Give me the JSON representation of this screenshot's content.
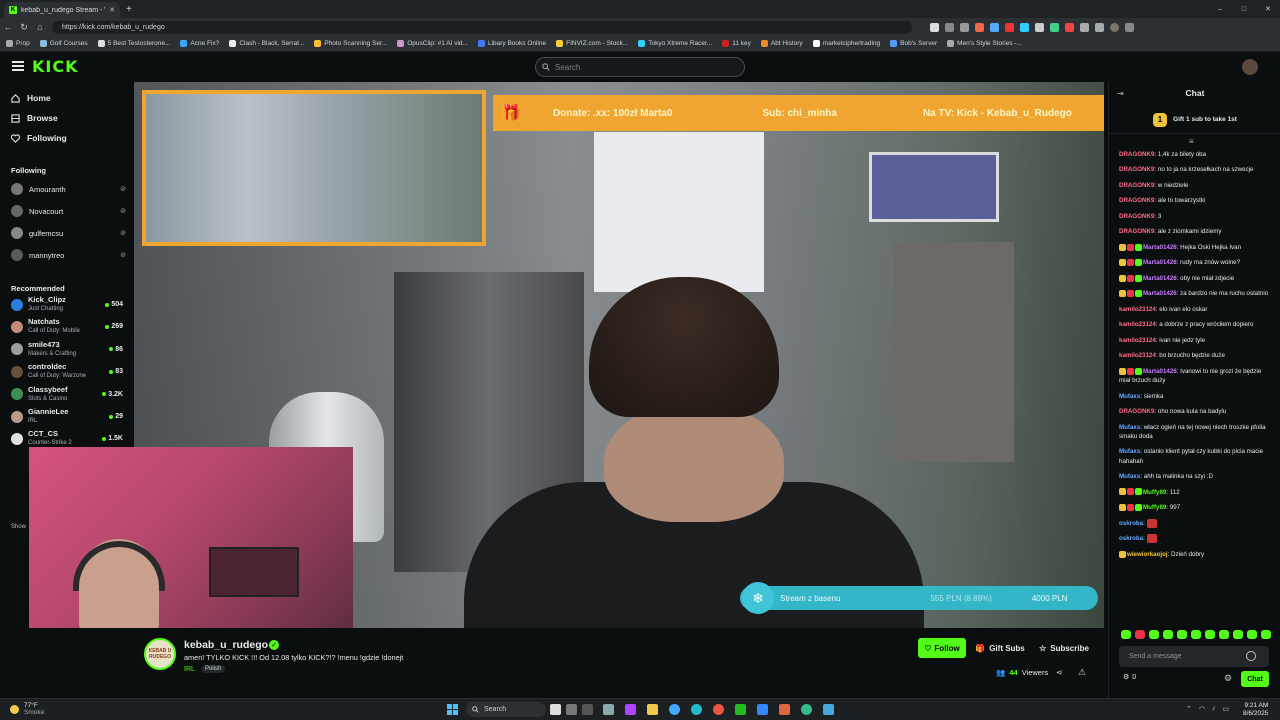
{
  "browser": {
    "tab_title": "kebab_u_rudego Stream - W",
    "new_tab": "+",
    "url": "https://kick.com/kebab_u_rudego",
    "bookmarks": [
      "Prop",
      "Golf Courses",
      "5 Best Testosterone...",
      "Acne Fix?",
      "Clash - Black, Serrat...",
      "Photo Scanning Ser...",
      "OpusClip: #1 AI vid...",
      "Libary Books Online",
      "FINVIZ.com - Stock...",
      "Tokyo Xtreme Racer...",
      "11 key",
      "Abt History",
      "marketciphertrading",
      "Bob's Server",
      "Men's Style Stories -..."
    ]
  },
  "header": {
    "logo": "KICK",
    "search_placeholder": "Search"
  },
  "sidebar": {
    "nav": [
      {
        "label": "Home"
      },
      {
        "label": "Browse"
      },
      {
        "label": "Following"
      }
    ],
    "following_title": "Following",
    "following": [
      {
        "name": "Amouranth"
      },
      {
        "name": "Novacourt"
      },
      {
        "name": "gulfemcsu"
      },
      {
        "name": "mannytreo"
      }
    ],
    "recommended_title": "Recommended",
    "recommended": [
      {
        "name": "Kick_Clipz",
        "category": "Just Chatting",
        "viewers": "504",
        "color": "#2a7ee0"
      },
      {
        "name": "Natchats",
        "category": "Call of Duty: Mobile",
        "viewers": "269",
        "color": "#c58b7a"
      },
      {
        "name": "smile473",
        "category": "Makers & Crafting",
        "viewers": "86",
        "color": "#9e9e9e"
      },
      {
        "name": "controldec",
        "category": "Call of Duty: Warzone",
        "viewers": "83",
        "color": "#6b4f3d"
      },
      {
        "name": "Classybeef",
        "category": "Slots & Casino",
        "viewers": "3.2K",
        "color": "#3e8f55"
      },
      {
        "name": "GiannieLee",
        "category": "IRL",
        "viewers": "29",
        "color": "#b99b8a"
      },
      {
        "name": "CCT_CS",
        "category": "Counter-Strike 2",
        "viewers": "1.5K",
        "color": "#e0e0e0"
      }
    ],
    "show_more": "Show"
  },
  "video": {
    "overlay_donate": "Donate: .xx: 100zł   Marta0",
    "overlay_sub": "Sub: chi_minha",
    "overlay_tv": "Na TV: Kick - Kebab_u_Rudego",
    "gauge_label": "Stream z basenu",
    "gauge_progress": "555 PLN (8.88%)",
    "gauge_goal": "4000 PLN"
  },
  "stream": {
    "channel": "kebab_u_rudego",
    "avatar_text": "KEBAB U RUDEGO",
    "title": "amen! TYLKO KICK !!! Od 12.08 tylko KICK?!? !menu !gdzie !donejt",
    "category": "IRL",
    "tag": "Polish",
    "follow": "Follow",
    "gift_subs": "Gift Subs",
    "subscribe": "Subscribe",
    "viewers": "44",
    "viewers_label": "Viewers"
  },
  "chat": {
    "title": "Chat",
    "gift_banner": "Gift 1 sub to take 1st",
    "input_placeholder": "Send a message",
    "points": "0",
    "send": "Chat",
    "messages": [
      {
        "user": "DRAGONK9",
        "color": "#ff6b8a",
        "text": "1,4k za bilety oba",
        "badges": 0
      },
      {
        "user": "DRAGONK9",
        "color": "#ff6b8a",
        "text": "no to ja na krzesełkach na szwecje",
        "badges": 0
      },
      {
        "user": "DRAGONK9",
        "color": "#ff6b8a",
        "text": "w niedziele",
        "badges": 0
      },
      {
        "user": "DRAGONK9",
        "color": "#ff6b8a",
        "text": "ale to towarzystki",
        "badges": 0
      },
      {
        "user": "DRAGONK9",
        "color": "#ff6b8a",
        "text": "3",
        "badges": 0
      },
      {
        "user": "DRAGONK9",
        "color": "#ff6b8a",
        "text": "ale z ziomkami idziemy",
        "badges": 0
      },
      {
        "user": "Marta01426",
        "color": "#c77dff",
        "text": "Hejka Oski Hejka Ivan",
        "badges": 3
      },
      {
        "user": "Marta01426",
        "color": "#c77dff",
        "text": "rudy ma znów wolne?",
        "badges": 3
      },
      {
        "user": "Marta01426",
        "color": "#c77dff",
        "text": "oby nie miał zdjecie",
        "badges": 3
      },
      {
        "user": "Marta01426",
        "color": "#c77dff",
        "text": "za bardzo nie ma ruchu ostatnio",
        "badges": 3
      },
      {
        "user": "kamilo23124",
        "color": "#ff6b8a",
        "text": "elo ivan elo oskar",
        "badges": 0
      },
      {
        "user": "kamilo23124",
        "color": "#ff6b8a",
        "text": "a dobrze z pracy wróciłem dopiero",
        "badges": 0
      },
      {
        "user": "kamilo23124",
        "color": "#ff6b8a",
        "text": "ivan nie jedz tyle",
        "badges": 0
      },
      {
        "user": "kamilo23124",
        "color": "#ff6b8a",
        "text": "bo brzucho będzie duże",
        "badges": 0
      },
      {
        "user": "Marta01426",
        "color": "#c77dff",
        "text": "Ivanowi to nie grozi że będzie miał brzuch duży",
        "badges": 3
      },
      {
        "user": "Mufaxs",
        "color": "#6aa8ff",
        "text": "siemka",
        "badges": 0
      },
      {
        "user": "DRAGONK9",
        "color": "#ff6b8a",
        "text": "oho nowa kula na badylu",
        "badges": 0
      },
      {
        "user": "Mufaxs",
        "color": "#6aa8ff",
        "text": "włacz ogień na tej nowej niech troszke pfolia smaku doda",
        "badges": 0
      },
      {
        "user": "Mufaxs",
        "color": "#6aa8ff",
        "text": "ostanio klient pytał czy kubki do picia macie hahahah",
        "badges": 0
      },
      {
        "user": "Mufaxs",
        "color": "#6aa8ff",
        "text": "ahh ta malinka na szyi :D",
        "badges": 0
      },
      {
        "user": "Muffy89",
        "color": "#53fc18",
        "text": "112",
        "badges": 3
      },
      {
        "user": "Muffy89",
        "color": "#53fc18",
        "text": "997",
        "badges": 3
      },
      {
        "user": "oskroba",
        "color": "#6aa8ff",
        "text": "",
        "badges": 0,
        "emote": true
      },
      {
        "user": "oskroba",
        "color": "#6aa8ff",
        "text": "",
        "badges": 0,
        "emote": true
      },
      {
        "user": "wiewiorkaojoj",
        "color": "#f0c33c",
        "text": "Dzień dobry",
        "badges": 1
      }
    ]
  },
  "taskbar": {
    "temp": "77°F",
    "weather": "Smoke",
    "search": "Search",
    "time": "9:21 AM",
    "date": "8/6/2025"
  }
}
